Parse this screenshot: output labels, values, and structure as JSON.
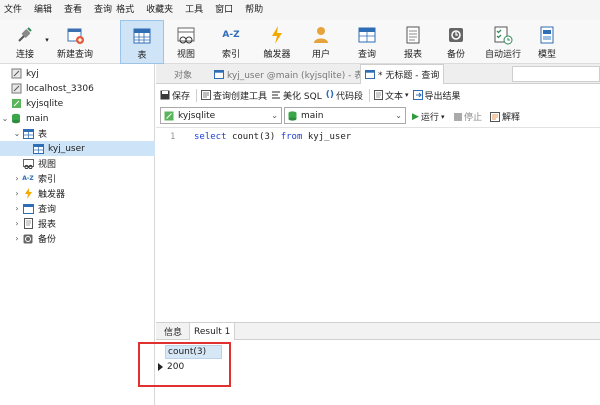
{
  "menu": [
    "文件",
    "编辑",
    "查看",
    "查询",
    "格式",
    "收藏夹",
    "工具",
    "窗口",
    "帮助"
  ],
  "toolbar": {
    "connect": "连接",
    "new_query": "新建查询",
    "table": "表",
    "view": "视图",
    "index": "索引",
    "trigger": "触发器",
    "user": "用户",
    "query": "查询",
    "report": "报表",
    "backup": "备份",
    "auto_run": "自动运行",
    "model": "模型",
    "index_icon_text": "A-Z"
  },
  "tree": {
    "items": [
      {
        "label": "kyj"
      },
      {
        "label": "localhost_3306"
      },
      {
        "label": "kyjsqlite"
      },
      {
        "label": "main"
      },
      {
        "label": "表"
      },
      {
        "label": "kyj_user"
      },
      {
        "label": "视图"
      },
      {
        "label": "索引"
      },
      {
        "label": "触发器"
      },
      {
        "label": "查询"
      },
      {
        "label": "报表"
      },
      {
        "label": "备份"
      }
    ]
  },
  "tabs": {
    "objects": "对象",
    "table_tab": "kyj_user @main (kyjsqlite) - 表",
    "query_tab": "* 无标题 - 查询"
  },
  "query_toolbar": {
    "save": "保存",
    "builder": "查询创建工具",
    "beautify": "美化 SQL",
    "snippet": "代码段",
    "text": "文本",
    "export": "导出结果"
  },
  "selectors": {
    "connection": "kyjsqlite",
    "database": "main",
    "run": "运行",
    "stop": "停止",
    "explain": "解释"
  },
  "editor": {
    "line_number": "1",
    "kw_select": "select",
    "fn": "count(3)",
    "kw_from": "from",
    "table": "kyj_user"
  },
  "result_tabs": {
    "info": "信息",
    "result": "Result 1"
  },
  "result": {
    "column": "count(3)",
    "value": "200"
  },
  "colors": {
    "accent": "#cfe4f7",
    "highlight_box": "#e03030",
    "keyword": "#1c3fd1"
  }
}
